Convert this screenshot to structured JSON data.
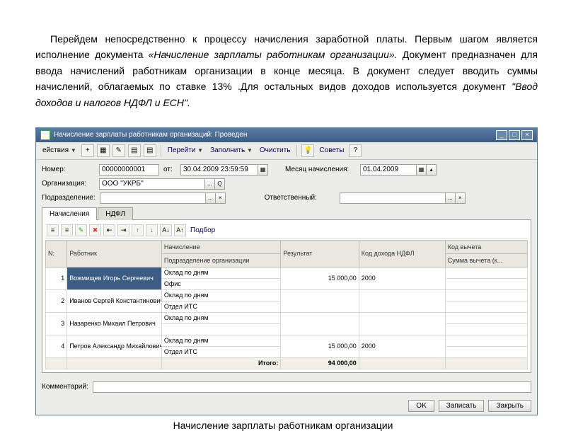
{
  "intro": {
    "p1a": "Перейдем непосредственно к процессу начисления заработной платы. Первым шагом является исполнение документа ",
    "p1b": "«Начисление зарплаты работникам организации».",
    "p1c": " Документ предназначен для ввода начислений работникам организации в конце месяца. В документ следует вводить суммы начислений, облагаемых по ставке 13% .Для остальных видов доходов используется документ ",
    "p1d": "\"Ввод доходов и налогов НДФЛ и ЕСН\"."
  },
  "window": {
    "title": "Начисление зарплаты работникам организаций: Проведен"
  },
  "toolbar": {
    "actions": "ействия",
    "goto": "Перейти",
    "fill": "Заполнить",
    "clear": "Очистить",
    "tips": "Советы"
  },
  "form": {
    "number_label": "Номер:",
    "number": "00000000001",
    "date_label": "от:",
    "date": "30.04.2009 23:59:59",
    "month_label": "Месяц начисления:",
    "month": "01.04.2009",
    "org_label": "Организация:",
    "org": "ООО \"УКРБ\"",
    "dept_label": "Подразделение:",
    "dept": "",
    "resp_label": "Ответственный:",
    "resp": ""
  },
  "tabs": {
    "t1": "Начисления",
    "t2": "НДФЛ"
  },
  "grid_toolbar": {
    "podbor": "Подбор"
  },
  "grid": {
    "headers": {
      "num": "N:",
      "employee": "Работник",
      "accrual": "Начисление",
      "result": "Результат",
      "ndfl_code": "Код дохода НДФЛ",
      "deduct_code": "Код вычета",
      "dept_sub": "Подразделение организации",
      "deduct_sum": "Сумма вычета (к..."
    },
    "rows": [
      {
        "n": "1",
        "emp": "Вожмищев Игорь Сергеевич",
        "accr": "Оклад по дням",
        "dept": "Офис",
        "res": "15 000,00",
        "ndfl": "2000"
      },
      {
        "n": "2",
        "emp": "Иванов Сергей Константинович",
        "accr": "Оклад по дням",
        "dept": "Отдел ИТС",
        "res": "",
        "ndfl": ""
      },
      {
        "n": "3",
        "emp": "Назаренко Михаил Петрович",
        "accr": "Оклад по дням",
        "dept": "",
        "res": "",
        "ndfl": ""
      },
      {
        "n": "4",
        "emp": "Петров Александр Михайлович",
        "accr": "Оклад по дням",
        "dept": "Отдел ИТС",
        "res": "15 000,00",
        "ndfl": "2000"
      }
    ],
    "total_label": "Итого:",
    "total": "94 000,00"
  },
  "footer": {
    "comment_label": "Комментарий:",
    "ok": "OK",
    "save": "Записать",
    "close": "Закрыть"
  },
  "caption": "Начисление зарплаты работникам организации"
}
